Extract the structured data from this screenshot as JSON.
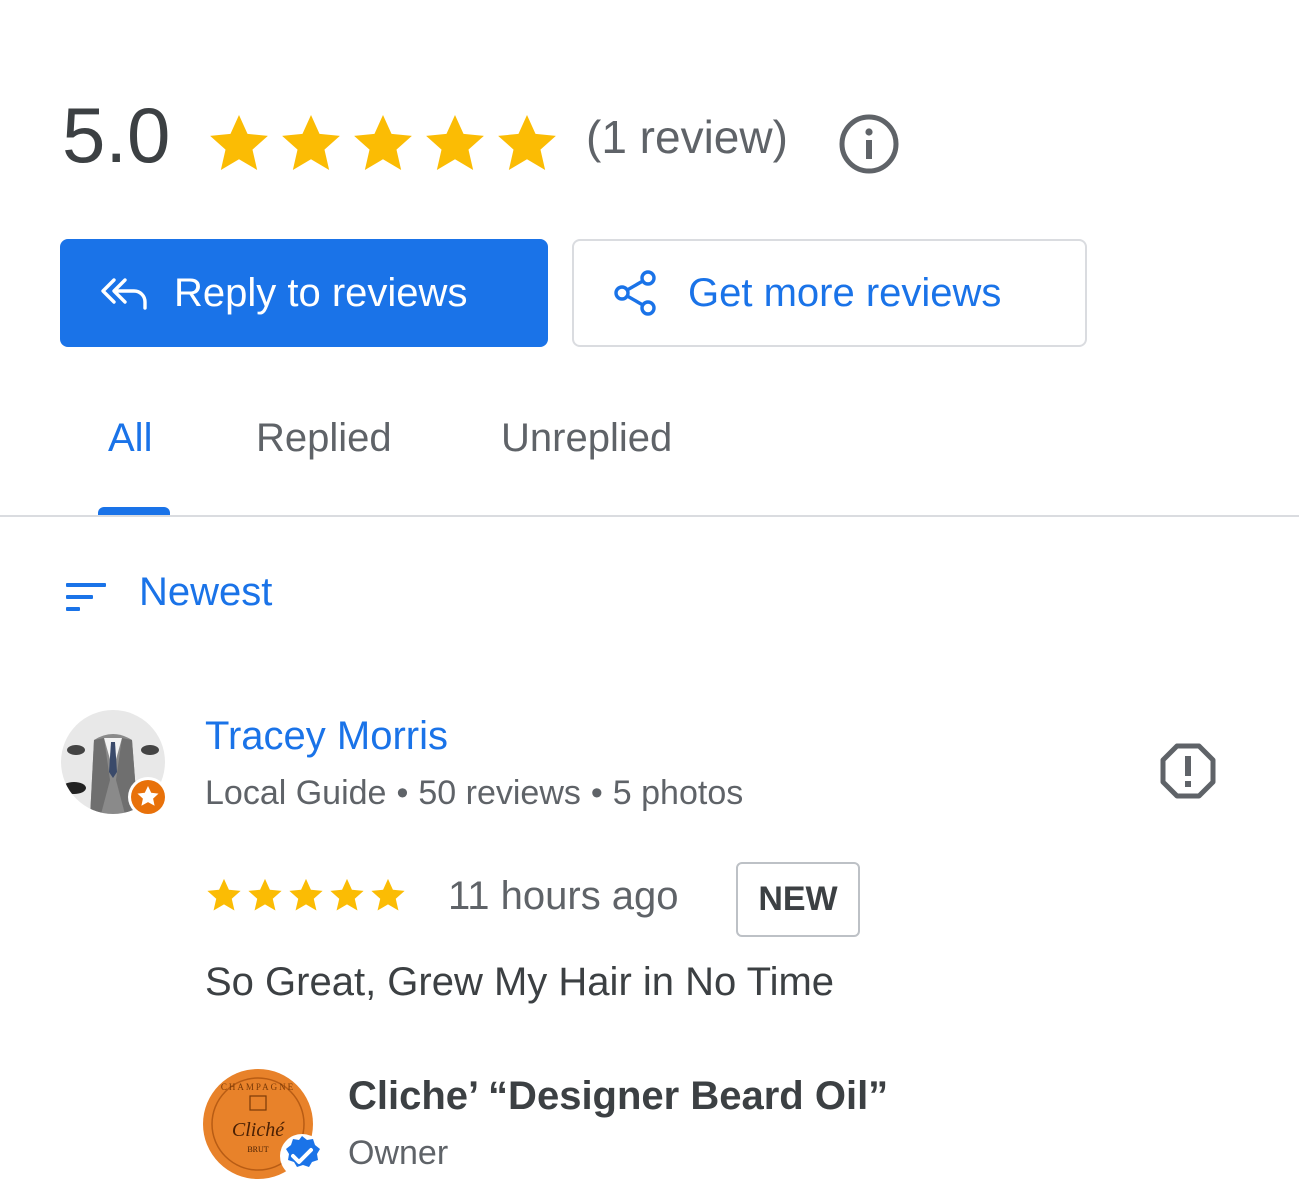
{
  "header": {
    "rating": "5.0",
    "stars": 5,
    "review_count": "(1 review)",
    "star_color": "#fbbc04"
  },
  "actions": {
    "reply_label": "Reply to reviews",
    "more_label": "Get more reviews",
    "accent": "#1a73e8"
  },
  "tabs": [
    {
      "label": "All",
      "active": true
    },
    {
      "label": "Replied",
      "active": false
    },
    {
      "label": "Unreplied",
      "active": false
    }
  ],
  "sort": {
    "label": "Newest"
  },
  "review": {
    "name": "Tracey Morris",
    "badge": "Local Guide",
    "reviews": "50 reviews",
    "photos": "5 photos",
    "stars": 5,
    "time": "11 hours ago",
    "new_label": "NEW",
    "text": "So Great, Grew My Hair in No Time"
  },
  "owner_reply": {
    "name": "Cliche’ “Designer Beard Oil”",
    "role": "Owner",
    "logo_text": "Cliché",
    "logo_top": "CHAMPAGNE",
    "logo_sub": "BRUT"
  }
}
